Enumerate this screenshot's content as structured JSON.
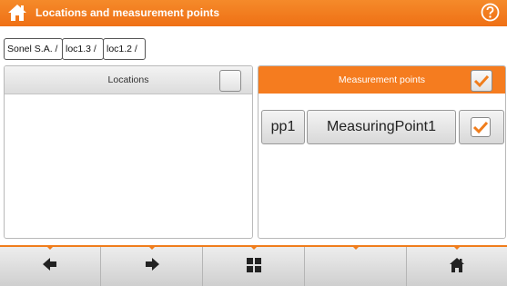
{
  "header": {
    "title": "Locations and measurement points",
    "home_icon": "home-icon",
    "help_icon": "help-icon",
    "accent": "#f07d1c"
  },
  "breadcrumb": [
    "Sonel S.A. /",
    "loc1.3 /",
    "loc1.2 /"
  ],
  "locations_panel": {
    "title": "Locations",
    "select_all_checked": false
  },
  "measurement_points_panel": {
    "title": "Measurement points",
    "select_all_checked": true,
    "items": [
      {
        "id": "pp1",
        "name": "MeasuringPoint1",
        "checked": true
      }
    ]
  },
  "bottom_bar": [
    {
      "icon": "arrow-left-icon"
    },
    {
      "icon": "arrow-right-icon"
    },
    {
      "icon": "grid-icon"
    },
    {
      "icon": ""
    },
    {
      "icon": "home-icon"
    }
  ]
}
